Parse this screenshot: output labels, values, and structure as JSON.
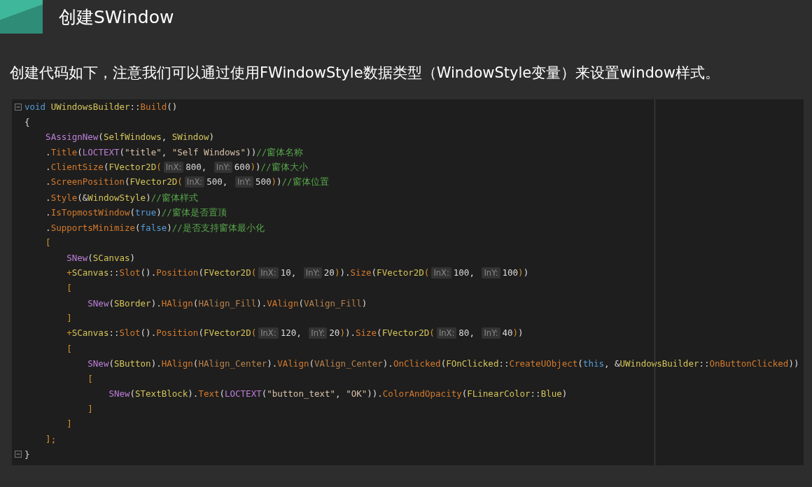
{
  "heading": "创建SWindow",
  "paragraph": "创建代码如下，注意我们可以通过使用FWindowStyle数据类型（WindowStyle变量）来设置window样式。",
  "code": {
    "lines": [
      {
        "fold": true,
        "tokens": [
          {
            "kind": "kw",
            "text": "void "
          },
          {
            "kind": "type",
            "text": "UWindowsBuilder"
          },
          {
            "kind": "plain",
            "text": "::"
          },
          {
            "kind": "fn",
            "text": "Build"
          },
          {
            "kind": "plain",
            "text": "()"
          }
        ]
      },
      {
        "fold": false,
        "tokens": [
          {
            "kind": "plain",
            "text": "{"
          }
        ]
      },
      {
        "fold": false,
        "tokens": [
          {
            "kind": "macro",
            "text": "    SAssignNew"
          },
          {
            "kind": "plain",
            "text": "("
          },
          {
            "kind": "type",
            "text": "SelfWindows"
          },
          {
            "kind": "plain",
            "text": ", "
          },
          {
            "kind": "type",
            "text": "SWindow"
          },
          {
            "kind": "plain",
            "text": ")"
          }
        ]
      },
      {
        "fold": false,
        "tokens": [
          {
            "kind": "plain",
            "text": "    ."
          },
          {
            "kind": "fn",
            "text": "Title"
          },
          {
            "kind": "plain",
            "text": "("
          },
          {
            "kind": "macro",
            "text": "LOCTEXT"
          },
          {
            "kind": "plain",
            "text": "("
          },
          {
            "kind": "str",
            "text": "\"title\""
          },
          {
            "kind": "plain",
            "text": ", "
          },
          {
            "kind": "str",
            "text": "\"Self Windows\""
          },
          {
            "kind": "plain",
            "text": "))"
          },
          {
            "kind": "cmt",
            "text": "//窗体名称"
          }
        ]
      },
      {
        "fold": false,
        "tokens": [
          {
            "kind": "plain",
            "text": "    ."
          },
          {
            "kind": "fn",
            "text": "ClientSize"
          },
          {
            "kind": "plain",
            "text": "("
          },
          {
            "kind": "type",
            "text": "FVector2D"
          },
          {
            "kind": "bracket",
            "text": "("
          },
          {
            "kind": "hint",
            "text": "InX:"
          },
          {
            "kind": "num",
            "text": "800"
          },
          {
            "kind": "plain",
            "text": ", "
          },
          {
            "kind": "hint",
            "text": "InY:"
          },
          {
            "kind": "num",
            "text": "600"
          },
          {
            "kind": "bracket",
            "text": ")"
          },
          {
            "kind": "plain",
            "text": ")"
          },
          {
            "kind": "cmt",
            "text": "//窗体大小"
          }
        ]
      },
      {
        "fold": false,
        "tokens": [
          {
            "kind": "plain",
            "text": "    ."
          },
          {
            "kind": "fn",
            "text": "ScreenPosition"
          },
          {
            "kind": "plain",
            "text": "("
          },
          {
            "kind": "type",
            "text": "FVector2D"
          },
          {
            "kind": "bracket",
            "text": "("
          },
          {
            "kind": "hint",
            "text": "InX:"
          },
          {
            "kind": "num",
            "text": "500"
          },
          {
            "kind": "plain",
            "text": ", "
          },
          {
            "kind": "hint",
            "text": "InY:"
          },
          {
            "kind": "num",
            "text": "500"
          },
          {
            "kind": "bracket",
            "text": ")"
          },
          {
            "kind": "plain",
            "text": ")"
          },
          {
            "kind": "cmt",
            "text": "//窗体位置"
          }
        ]
      },
      {
        "fold": false,
        "tokens": [
          {
            "kind": "plain",
            "text": "    ."
          },
          {
            "kind": "fn",
            "text": "Style"
          },
          {
            "kind": "plain",
            "text": "(&"
          },
          {
            "kind": "type",
            "text": "WindowStyle"
          },
          {
            "kind": "plain",
            "text": ")"
          },
          {
            "kind": "cmt",
            "text": "//窗体样式"
          }
        ]
      },
      {
        "fold": false,
        "tokens": [
          {
            "kind": "plain",
            "text": "    ."
          },
          {
            "kind": "fn",
            "text": "IsTopmostWindow"
          },
          {
            "kind": "plain",
            "text": "("
          },
          {
            "kind": "kw",
            "text": "true"
          },
          {
            "kind": "plain",
            "text": ")"
          },
          {
            "kind": "cmt",
            "text": "//窗体是否置顶"
          }
        ]
      },
      {
        "fold": false,
        "tokens": [
          {
            "kind": "plain",
            "text": "    ."
          },
          {
            "kind": "fn",
            "text": "SupportsMinimize"
          },
          {
            "kind": "plain",
            "text": "("
          },
          {
            "kind": "kw",
            "text": "false"
          },
          {
            "kind": "plain",
            "text": ")"
          },
          {
            "kind": "cmt",
            "text": "//是否支持窗体最小化"
          }
        ]
      },
      {
        "fold": false,
        "tokens": [
          {
            "kind": "bracket",
            "text": "    ["
          }
        ]
      },
      {
        "fold": false,
        "tokens": [
          {
            "kind": "macro",
            "text": "        SNew"
          },
          {
            "kind": "plain",
            "text": "("
          },
          {
            "kind": "type",
            "text": "SCanvas"
          },
          {
            "kind": "plain",
            "text": ")"
          }
        ]
      },
      {
        "fold": false,
        "tokens": [
          {
            "kind": "bracket",
            "text": "        +"
          },
          {
            "kind": "type",
            "text": "SCanvas"
          },
          {
            "kind": "plain",
            "text": "::"
          },
          {
            "kind": "fn",
            "text": "Slot"
          },
          {
            "kind": "plain",
            "text": "()."
          },
          {
            "kind": "fn",
            "text": "Position"
          },
          {
            "kind": "plain",
            "text": "("
          },
          {
            "kind": "type",
            "text": "FVector2D"
          },
          {
            "kind": "bracket",
            "text": "("
          },
          {
            "kind": "hint",
            "text": "InX:"
          },
          {
            "kind": "num",
            "text": "10"
          },
          {
            "kind": "plain",
            "text": ", "
          },
          {
            "kind": "hint",
            "text": "InY:"
          },
          {
            "kind": "num",
            "text": "20"
          },
          {
            "kind": "bracket",
            "text": ")"
          },
          {
            "kind": "plain",
            "text": ")."
          },
          {
            "kind": "fn",
            "text": "Size"
          },
          {
            "kind": "plain",
            "text": "("
          },
          {
            "kind": "type",
            "text": "FVector2D"
          },
          {
            "kind": "bracket",
            "text": "("
          },
          {
            "kind": "hint",
            "text": "InX:"
          },
          {
            "kind": "num",
            "text": "100"
          },
          {
            "kind": "plain",
            "text": ", "
          },
          {
            "kind": "hint",
            "text": "InY:"
          },
          {
            "kind": "num",
            "text": "100"
          },
          {
            "kind": "bracket",
            "text": ")"
          },
          {
            "kind": "plain",
            "text": ")"
          }
        ]
      },
      {
        "fold": false,
        "tokens": [
          {
            "kind": "bracket",
            "text": "        ["
          }
        ]
      },
      {
        "fold": false,
        "tokens": [
          {
            "kind": "macro",
            "text": "            SNew"
          },
          {
            "kind": "plain",
            "text": "("
          },
          {
            "kind": "type",
            "text": "SBorder"
          },
          {
            "kind": "plain",
            "text": ")."
          },
          {
            "kind": "fn",
            "text": "HAlign"
          },
          {
            "kind": "plain",
            "text": "("
          },
          {
            "kind": "enum",
            "text": "HAlign_Fill"
          },
          {
            "kind": "plain",
            "text": ")."
          },
          {
            "kind": "fn",
            "text": "VAlign"
          },
          {
            "kind": "plain",
            "text": "("
          },
          {
            "kind": "enum",
            "text": "VAlign_Fill"
          },
          {
            "kind": "plain",
            "text": ")"
          }
        ]
      },
      {
        "fold": false,
        "tokens": [
          {
            "kind": "bracket",
            "text": "        ]"
          }
        ]
      },
      {
        "fold": false,
        "tokens": [
          {
            "kind": "bracket",
            "text": "        +"
          },
          {
            "kind": "type",
            "text": "SCanvas"
          },
          {
            "kind": "plain",
            "text": "::"
          },
          {
            "kind": "fn",
            "text": "Slot"
          },
          {
            "kind": "plain",
            "text": "()."
          },
          {
            "kind": "fn",
            "text": "Position"
          },
          {
            "kind": "plain",
            "text": "("
          },
          {
            "kind": "type",
            "text": "FVector2D"
          },
          {
            "kind": "bracket",
            "text": "("
          },
          {
            "kind": "hint",
            "text": "InX:"
          },
          {
            "kind": "num",
            "text": "120"
          },
          {
            "kind": "plain",
            "text": ", "
          },
          {
            "kind": "hint",
            "text": "InY:"
          },
          {
            "kind": "num",
            "text": "20"
          },
          {
            "kind": "bracket",
            "text": ")"
          },
          {
            "kind": "plain",
            "text": ")."
          },
          {
            "kind": "fn",
            "text": "Size"
          },
          {
            "kind": "plain",
            "text": "("
          },
          {
            "kind": "type",
            "text": "FVector2D"
          },
          {
            "kind": "bracket",
            "text": "("
          },
          {
            "kind": "hint",
            "text": "InX:"
          },
          {
            "kind": "num",
            "text": "80"
          },
          {
            "kind": "plain",
            "text": ", "
          },
          {
            "kind": "hint",
            "text": "InY:"
          },
          {
            "kind": "num",
            "text": "40"
          },
          {
            "kind": "bracket",
            "text": ")"
          },
          {
            "kind": "plain",
            "text": ")"
          }
        ]
      },
      {
        "fold": false,
        "tokens": [
          {
            "kind": "bracket",
            "text": "        ["
          }
        ]
      },
      {
        "fold": false,
        "tokens": [
          {
            "kind": "macro",
            "text": "            SNew"
          },
          {
            "kind": "plain",
            "text": "("
          },
          {
            "kind": "type",
            "text": "SButton"
          },
          {
            "kind": "plain",
            "text": ")."
          },
          {
            "kind": "fn",
            "text": "HAlign"
          },
          {
            "kind": "plain",
            "text": "("
          },
          {
            "kind": "enum",
            "text": "HAlign_Center"
          },
          {
            "kind": "plain",
            "text": ")."
          },
          {
            "kind": "fn",
            "text": "VAlign"
          },
          {
            "kind": "plain",
            "text": "("
          },
          {
            "kind": "enum",
            "text": "VAlign_Center"
          },
          {
            "kind": "plain",
            "text": ")."
          },
          {
            "kind": "fn",
            "text": "OnClicked"
          },
          {
            "kind": "plain",
            "text": "("
          },
          {
            "kind": "type",
            "text": "FOnClicked"
          },
          {
            "kind": "plain",
            "text": "::"
          },
          {
            "kind": "fn",
            "text": "CreateUObject"
          },
          {
            "kind": "plain",
            "text": "("
          },
          {
            "kind": "kw",
            "text": "this"
          },
          {
            "kind": "plain",
            "text": ", &"
          },
          {
            "kind": "type",
            "text": "UWindowsBuilder"
          },
          {
            "kind": "plain",
            "text": "::"
          },
          {
            "kind": "fn",
            "text": "OnButtonClicked"
          },
          {
            "kind": "plain",
            "text": "))"
          }
        ]
      },
      {
        "fold": false,
        "tokens": [
          {
            "kind": "bracket",
            "text": "            ["
          }
        ]
      },
      {
        "fold": false,
        "tokens": [
          {
            "kind": "macro",
            "text": "                SNew"
          },
          {
            "kind": "plain",
            "text": "("
          },
          {
            "kind": "type",
            "text": "STextBlock"
          },
          {
            "kind": "plain",
            "text": ")."
          },
          {
            "kind": "fn",
            "text": "Text"
          },
          {
            "kind": "plain",
            "text": "("
          },
          {
            "kind": "macro",
            "text": "LOCTEXT"
          },
          {
            "kind": "plain",
            "text": "("
          },
          {
            "kind": "str",
            "text": "\"button_text\""
          },
          {
            "kind": "plain",
            "text": ", "
          },
          {
            "kind": "str",
            "text": "\"OK\""
          },
          {
            "kind": "plain",
            "text": "))."
          },
          {
            "kind": "fn",
            "text": "ColorAndOpacity"
          },
          {
            "kind": "plain",
            "text": "("
          },
          {
            "kind": "type",
            "text": "FLinearColor"
          },
          {
            "kind": "plain",
            "text": "::"
          },
          {
            "kind": "type",
            "text": "Blue"
          },
          {
            "kind": "plain",
            "text": ")"
          }
        ]
      },
      {
        "fold": false,
        "tokens": [
          {
            "kind": "bracket",
            "text": "            ]"
          }
        ]
      },
      {
        "fold": false,
        "tokens": [
          {
            "kind": "bracket",
            "text": "        ]"
          }
        ]
      },
      {
        "fold": false,
        "tokens": [
          {
            "kind": "bracket",
            "text": "    ];"
          }
        ]
      },
      {
        "fold": true,
        "tokens": [
          {
            "kind": "plain",
            "text": "}"
          }
        ]
      }
    ]
  }
}
